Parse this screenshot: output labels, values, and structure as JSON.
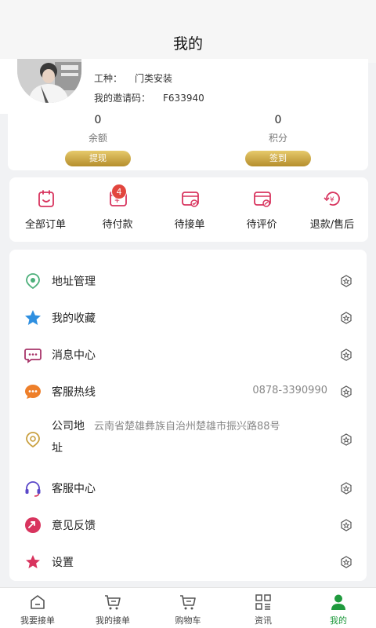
{
  "header": {
    "title": "我的"
  },
  "profile": {
    "trade_label": "工种：",
    "trade_value": "门类安装",
    "invite_label": "我的邀请码：",
    "invite_value": "F633940"
  },
  "stats": {
    "balance": {
      "value": "0",
      "label": "余额",
      "button": "提现"
    },
    "points": {
      "value": "0",
      "label": "积分",
      "button": "签到"
    }
  },
  "orders": [
    {
      "label": "全部订单",
      "icon": "clipboard-icon"
    },
    {
      "label": "待付款",
      "icon": "yen-card-icon",
      "badge": "4"
    },
    {
      "label": "待接单",
      "icon": "card-check-icon"
    },
    {
      "label": "待评价",
      "icon": "card-edit-icon"
    },
    {
      "label": "退款/售后",
      "icon": "yen-refresh-icon"
    }
  ],
  "menu": [
    {
      "label": "地址管理",
      "icon": "location-icon",
      "color": "#4caf7a"
    },
    {
      "label": "我的收藏",
      "icon": "star-icon",
      "color": "#2e8fe0"
    },
    {
      "label": "消息中心",
      "icon": "chat-icon",
      "color": "#a8356a"
    },
    {
      "label": "客服热线",
      "icon": "chat-bubble-icon",
      "color": "#ee7f2a",
      "value": "0878-3390990"
    },
    {
      "label": "公司地",
      "label_wrap": "址",
      "icon": "location-outline-icon",
      "color": "#c9a040",
      "value": "云南省楚雄彝族自治州楚雄市振兴路88号"
    },
    {
      "label": "客服中心",
      "icon": "headset-icon",
      "color": "#5a47c8"
    },
    {
      "label": "意见反馈",
      "icon": "feedback-icon",
      "color": "#d8345e"
    },
    {
      "label": "设置",
      "icon": "settings-star-icon",
      "color": "#d8345e"
    }
  ],
  "tabs": [
    {
      "label": "我要接单",
      "icon": "home-icon"
    },
    {
      "label": "我的接单",
      "icon": "cart-icon"
    },
    {
      "label": "购物车",
      "icon": "cart-icon"
    },
    {
      "label": "资讯",
      "icon": "grid-icon"
    },
    {
      "label": "我的",
      "icon": "person-icon",
      "active": true
    }
  ],
  "colors": {
    "accent": "#1f9a3d",
    "gold": "#c9a040",
    "badge": "#e2463e"
  }
}
